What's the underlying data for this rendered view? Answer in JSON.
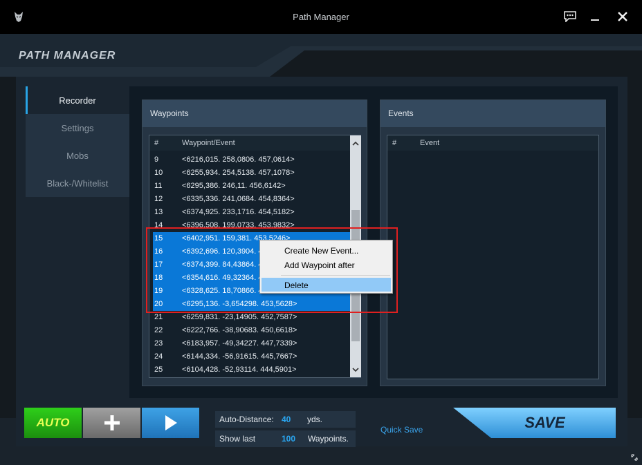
{
  "window": {
    "title": "Path Manager",
    "icons": {
      "app": "wolf-head-icon",
      "chat": "chat-bubble-icon",
      "minimize": "minimize-icon",
      "close": "close-icon"
    }
  },
  "logo": "PATH MANAGER",
  "nav": {
    "items": [
      {
        "label": "Recorder",
        "active": true
      },
      {
        "label": "Settings",
        "active": false
      },
      {
        "label": "Mobs",
        "active": false
      },
      {
        "label": "Black-/Whitelist",
        "active": false
      }
    ]
  },
  "waypoints": {
    "title": "Waypoints",
    "col_num": "#",
    "col_name": "Waypoint/Event",
    "rows": [
      {
        "num": "9",
        "text": "<6216,015. 258,0806. 457,0614>",
        "selected": false
      },
      {
        "num": "10",
        "text": "<6255,934. 254,5138. 457,1078>",
        "selected": false
      },
      {
        "num": "11",
        "text": "<6295,386. 246,11. 456,6142>",
        "selected": false
      },
      {
        "num": "12",
        "text": "<6335,336. 241,0684. 454,8364>",
        "selected": false
      },
      {
        "num": "13",
        "text": "<6374,925. 233,1716. 454,5182>",
        "selected": false
      },
      {
        "num": "14",
        "text": "<6396,508. 199,0733. 453,9832>",
        "selected": false
      },
      {
        "num": "15",
        "text": "<6402,951. 159,381. 453,5246>",
        "selected": true
      },
      {
        "num": "16",
        "text": "<6392,696. 120,3904. 4",
        "selected": true
      },
      {
        "num": "17",
        "text": "<6374,399. 84,43864. 4",
        "selected": true
      },
      {
        "num": "18",
        "text": "<6354,616. 49,32364. 4",
        "selected": true
      },
      {
        "num": "19",
        "text": "<6328,625. 18,70866. 4",
        "selected": true
      },
      {
        "num": "20",
        "text": "<6295,136. -3,654298. 453,5628>",
        "selected": true
      },
      {
        "num": "21",
        "text": "<6259,831. -23,14905. 452,7587>",
        "selected": false
      },
      {
        "num": "22",
        "text": "<6222,766. -38,90683. 450,6618>",
        "selected": false
      },
      {
        "num": "23",
        "text": "<6183,957. -49,34227. 447,7339>",
        "selected": false
      },
      {
        "num": "24",
        "text": "<6144,334. -56,91615. 445,7667>",
        "selected": false
      },
      {
        "num": "25",
        "text": "<6104,428. -52,93114. 444,5901>",
        "selected": false
      }
    ]
  },
  "events": {
    "title": "Events",
    "col_num": "#",
    "col_name": "Event"
  },
  "context_menu": {
    "items": [
      {
        "label": "Create New Event...",
        "highlighted": false
      },
      {
        "label": "Add Waypoint after",
        "highlighted": false
      },
      {
        "label": "Delete",
        "highlighted": true
      }
    ]
  },
  "controls": {
    "auto_label": "AUTO",
    "add_icon": "plus-icon",
    "play_icon": "play-icon",
    "auto_distance_label": "Auto-Distance:",
    "auto_distance_value": "40",
    "auto_distance_unit": "yds.",
    "show_last_label": "Show last",
    "show_last_value": "100",
    "show_last_unit": "Waypoints.",
    "quick_save": "Quick Save",
    "save_label": "SAVE"
  },
  "colors": {
    "accent_blue": "#29a4e6",
    "selection": "#0a78d7",
    "auto_green": "#2ecf1a",
    "highlight_red": "#e02020"
  }
}
